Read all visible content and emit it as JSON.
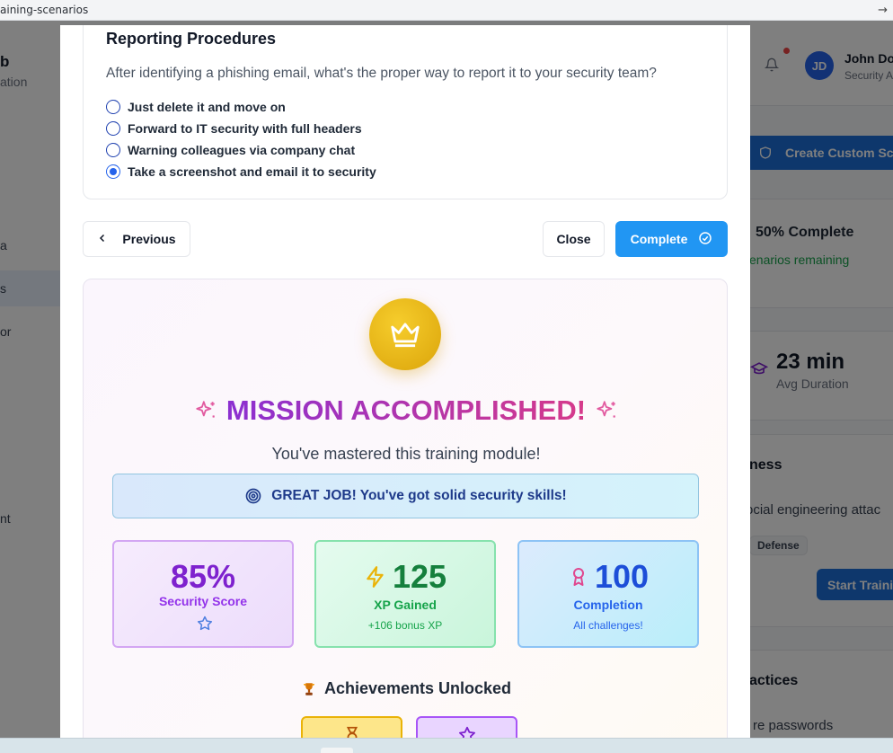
{
  "browser": {
    "url": "aining-scenarios"
  },
  "sidebar": {
    "brand": "b",
    "brand_sub": "ation",
    "items": [
      {
        "label": "a"
      },
      {
        "label": "s"
      },
      {
        "label": "or"
      },
      {
        "label": "nt"
      }
    ]
  },
  "header": {
    "avatar_initials": "JD",
    "user_name": "John Doe",
    "user_role": "Security A"
  },
  "background": {
    "create_button": "Create Custom Sce",
    "progress": "50% Complete",
    "remaining": "enarios remaining",
    "duration_value": "23 min",
    "duration_label": "Avg Duration",
    "section_title": "ness",
    "section_desc": "ocial engineering attac",
    "badge": "Defense",
    "start_button": "Start Trainin",
    "practices_title": "actices",
    "practices_item": "re passwords"
  },
  "modal": {
    "question": {
      "title": "Reporting Procedures",
      "text": "After identifying a phishing email, what's the proper way to report it to your security team?",
      "options": [
        {
          "label": "Just delete it and move on",
          "selected": false
        },
        {
          "label": "Forward to IT security with full headers",
          "selected": false
        },
        {
          "label": "Warning colleagues via company chat",
          "selected": false
        },
        {
          "label": "Take a screenshot and email it to security",
          "selected": true
        }
      ]
    },
    "buttons": {
      "previous": "Previous",
      "close": "Close",
      "complete": "Complete"
    },
    "result": {
      "heading": "MISSION ACCOMPLISHED!",
      "subheading": "You've mastered this training module!",
      "banner": "GREAT JOB! You've got solid security skills!",
      "stats": [
        {
          "value": "85%",
          "label": "Security Score",
          "sub": ""
        },
        {
          "value": "125",
          "label": "XP Gained",
          "sub": "+106 bonus XP"
        },
        {
          "value": "100",
          "label": "Completion",
          "sub": "All challenges!"
        }
      ],
      "achievements_title": "Achievements Unlocked"
    }
  },
  "colors": {
    "primary": "#2196f3",
    "gold": "#e0a90f",
    "heading_gradient_start": "#8b2fd1",
    "heading_gradient_end": "#d63a8a"
  }
}
